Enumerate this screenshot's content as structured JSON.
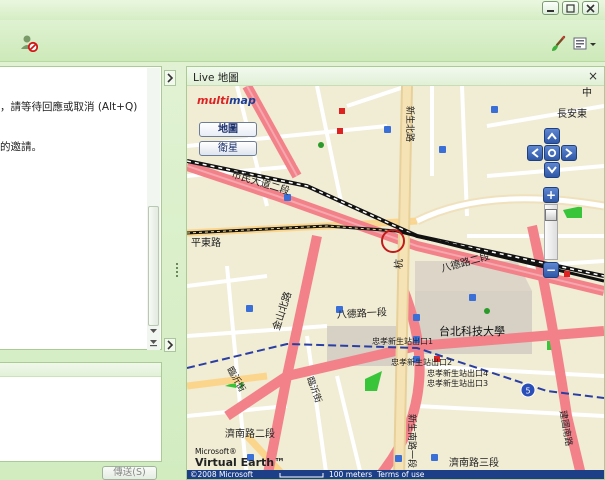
{
  "window": {
    "controls": [
      {
        "name": "minimize-button",
        "icon": "minimize-icon"
      },
      {
        "name": "restore-button",
        "icon": "restore-icon"
      },
      {
        "name": "close-button",
        "icon": "close-icon"
      }
    ]
  },
  "toolbar": {
    "icons": [
      "block-contact-icon",
      "paint-brush-icon",
      "menu-icon"
    ]
  },
  "chat": {
    "lines": [
      "，請等待回應或取消 (Alt+Q)",
      "的邀請。"
    ],
    "send_label": "傳送(S)"
  },
  "map_panel": {
    "title": "Live 地圖",
    "close": "×",
    "logo": "multimap",
    "view_buttons": {
      "map": "地圖",
      "satellite": "衛星"
    },
    "zoom_in": "+",
    "zoom_out": "−",
    "labels": {
      "top_right": "長安東",
      "top_edge": "中",
      "civic_blvd": "市民大道二段",
      "bade_rd_1": "八德路一段",
      "bade_rd_2": "八德路二段",
      "jinshan_north": "金山北路",
      "pingdong": "平東路",
      "hangzhou": "杭",
      "university": "台北科技大學",
      "stn_exit1": "忠孝新生站出口1",
      "stn_exit2": "忠孝新生站出口2",
      "stn_exit4": "忠孝新生站出口4",
      "stn_exit3": "忠孝新生站出口3",
      "jinan_2": "濟南路二段",
      "jinan_3": "濟南路三段",
      "xinsheng_south": "建國南路",
      "xinsheng_road": "新生南路一段",
      "linyi": "臨沂街",
      "jinan_road_mid": "臨沂街",
      "xinsheng_north": "新生北路",
      "jianguo": "建國南路",
      "route_shield": "5"
    },
    "footer": {
      "brand_top": "Microsoft®",
      "brand": "Virtual Earth™",
      "copyright": "©2008 Microsoft",
      "scale": "100 meters",
      "terms": "Terms of use"
    }
  },
  "colors": {
    "road_major": "#f2818a",
    "road_minor": "#ffffff",
    "road_secondary": "#fbd58c",
    "park": "#39c53a",
    "campus": "#d6d0c5",
    "rail": "#111111"
  }
}
